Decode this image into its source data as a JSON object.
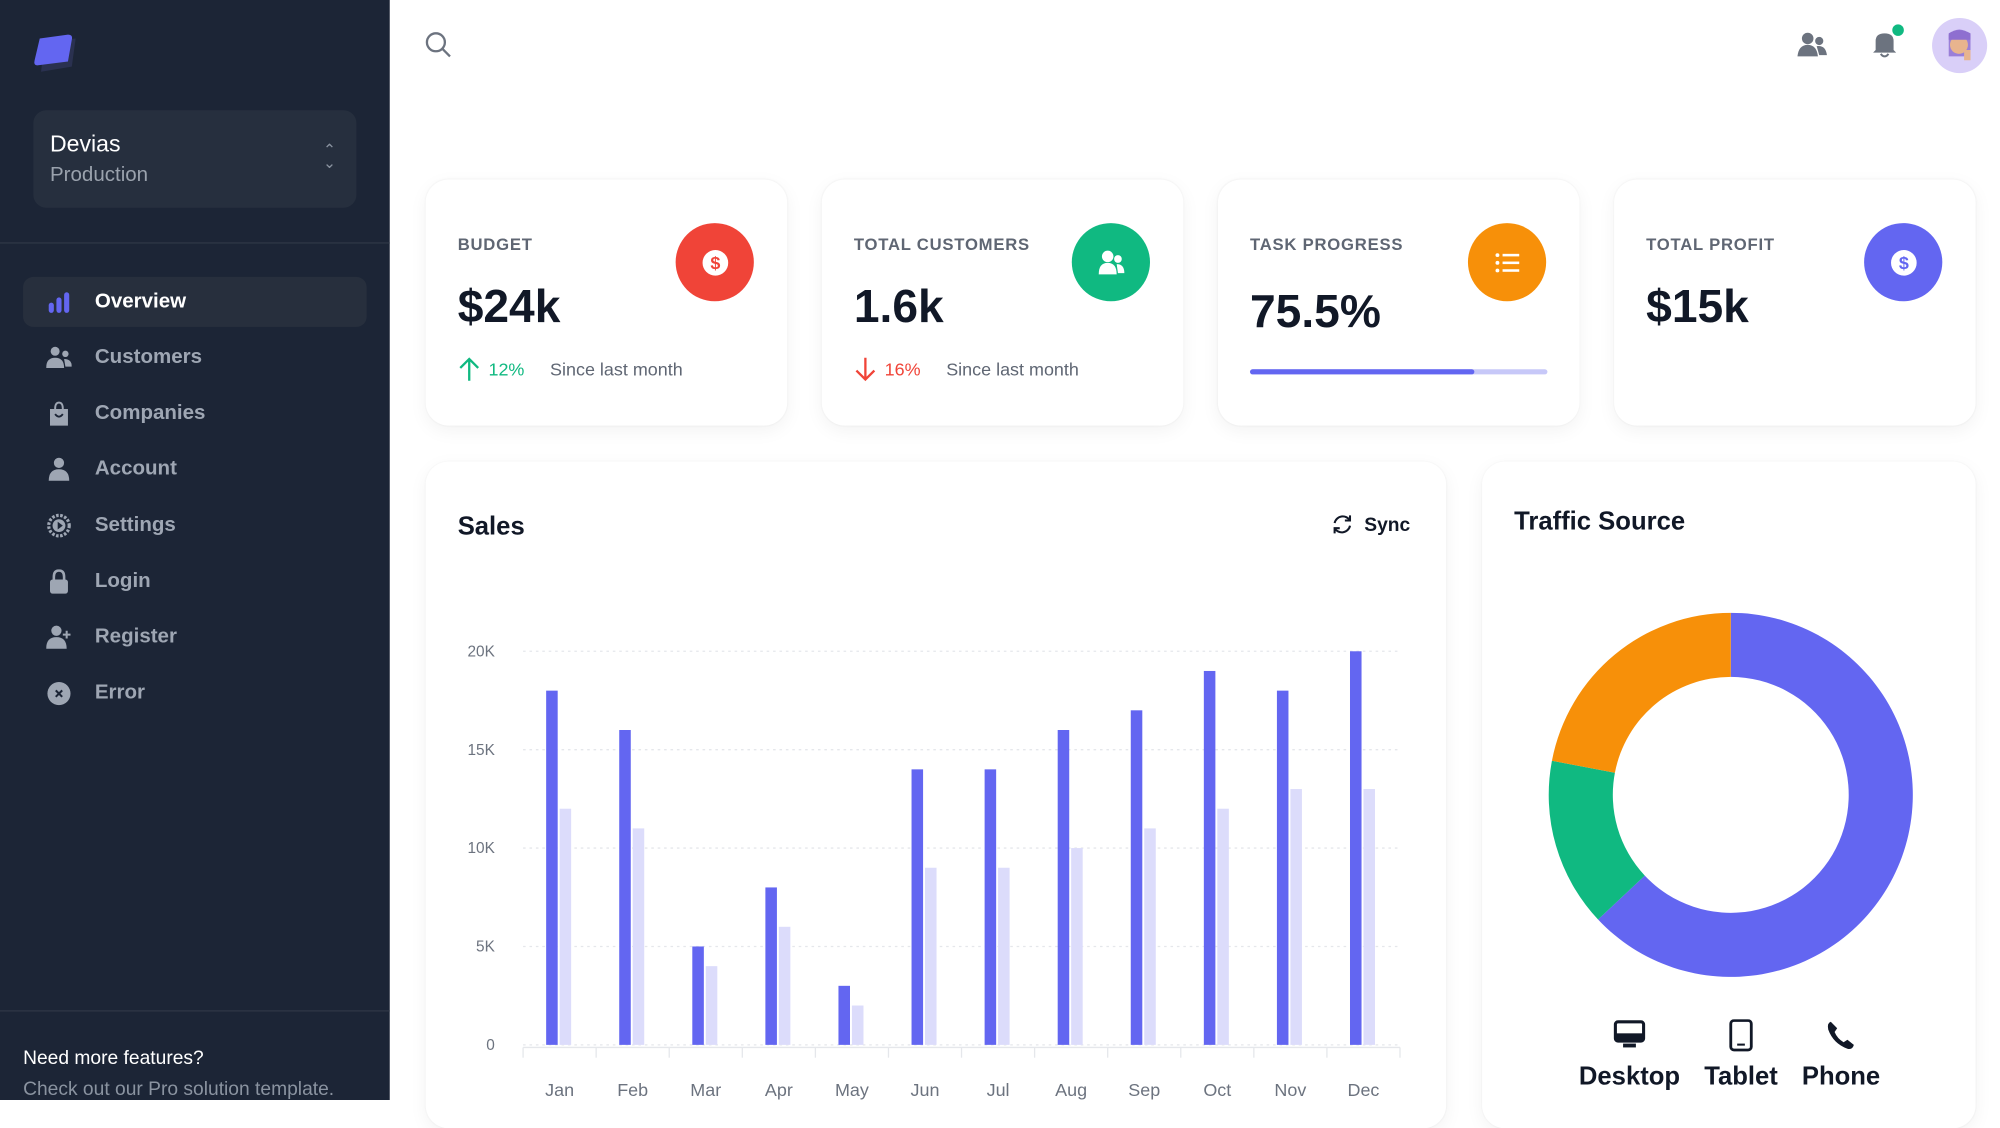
{
  "workspace": {
    "name": "Devias",
    "env": "Production"
  },
  "nav": [
    {
      "label": "Overview",
      "icon": "chart-bar-icon",
      "active": true
    },
    {
      "label": "Customers",
      "icon": "users-icon"
    },
    {
      "label": "Companies",
      "icon": "shopping-bag-icon"
    },
    {
      "label": "Account",
      "icon": "user-icon"
    },
    {
      "label": "Settings",
      "icon": "cog-icon"
    },
    {
      "label": "Login",
      "icon": "lock-icon"
    },
    {
      "label": "Register",
      "icon": "user-plus-icon"
    },
    {
      "label": "Error",
      "icon": "x-circle-icon"
    }
  ],
  "footer": {
    "title": "Need more features?",
    "text": "Check out our Pro solution template."
  },
  "kpis": {
    "budget": {
      "label": "BUDGET",
      "value": "$24k",
      "trend": "12%",
      "trend_dir": "up",
      "since": "Since last month",
      "color": "#f04438"
    },
    "customers": {
      "label": "TOTAL CUSTOMERS",
      "value": "1.6k",
      "trend": "16%",
      "trend_dir": "down",
      "since": "Since last month",
      "color": "#10b981"
    },
    "task": {
      "label": "TASK PROGRESS",
      "value": "75.5%",
      "progress": 75.5,
      "color": "#f79009"
    },
    "profit": {
      "label": "TOTAL PROFIT",
      "value": "$15k",
      "color": "#6366f1"
    }
  },
  "sales": {
    "title": "Sales",
    "sync_label": "Sync"
  },
  "traffic": {
    "title": "Traffic Source"
  },
  "chart_data": [
    {
      "type": "bar",
      "title": "Sales",
      "categories": [
        "Jan",
        "Feb",
        "Mar",
        "Apr",
        "May",
        "Jun",
        "Jul",
        "Aug",
        "Sep",
        "Oct",
        "Nov",
        "Dec"
      ],
      "series": [
        {
          "values": [
            18,
            16,
            5,
            8,
            3,
            14,
            14,
            16,
            17,
            19,
            18,
            20
          ],
          "color": "#6366f1"
        },
        {
          "values": [
            12,
            11,
            4,
            6,
            2,
            9,
            9,
            10,
            11,
            12,
            13,
            13
          ],
          "color": "#dcdcfb"
        }
      ],
      "yticks": [
        "0",
        "5K",
        "10K",
        "15K",
        "20K"
      ],
      "ylim": [
        0,
        20
      ],
      "yunit": "K",
      "grid": true
    },
    {
      "type": "pie",
      "title": "Traffic Source",
      "labels": [
        "Desktop",
        "Tablet",
        "Phone"
      ],
      "values": [
        63,
        15,
        22
      ],
      "colors": [
        "#6366f1",
        "#10b981",
        "#f79009"
      ],
      "donut": true
    }
  ]
}
